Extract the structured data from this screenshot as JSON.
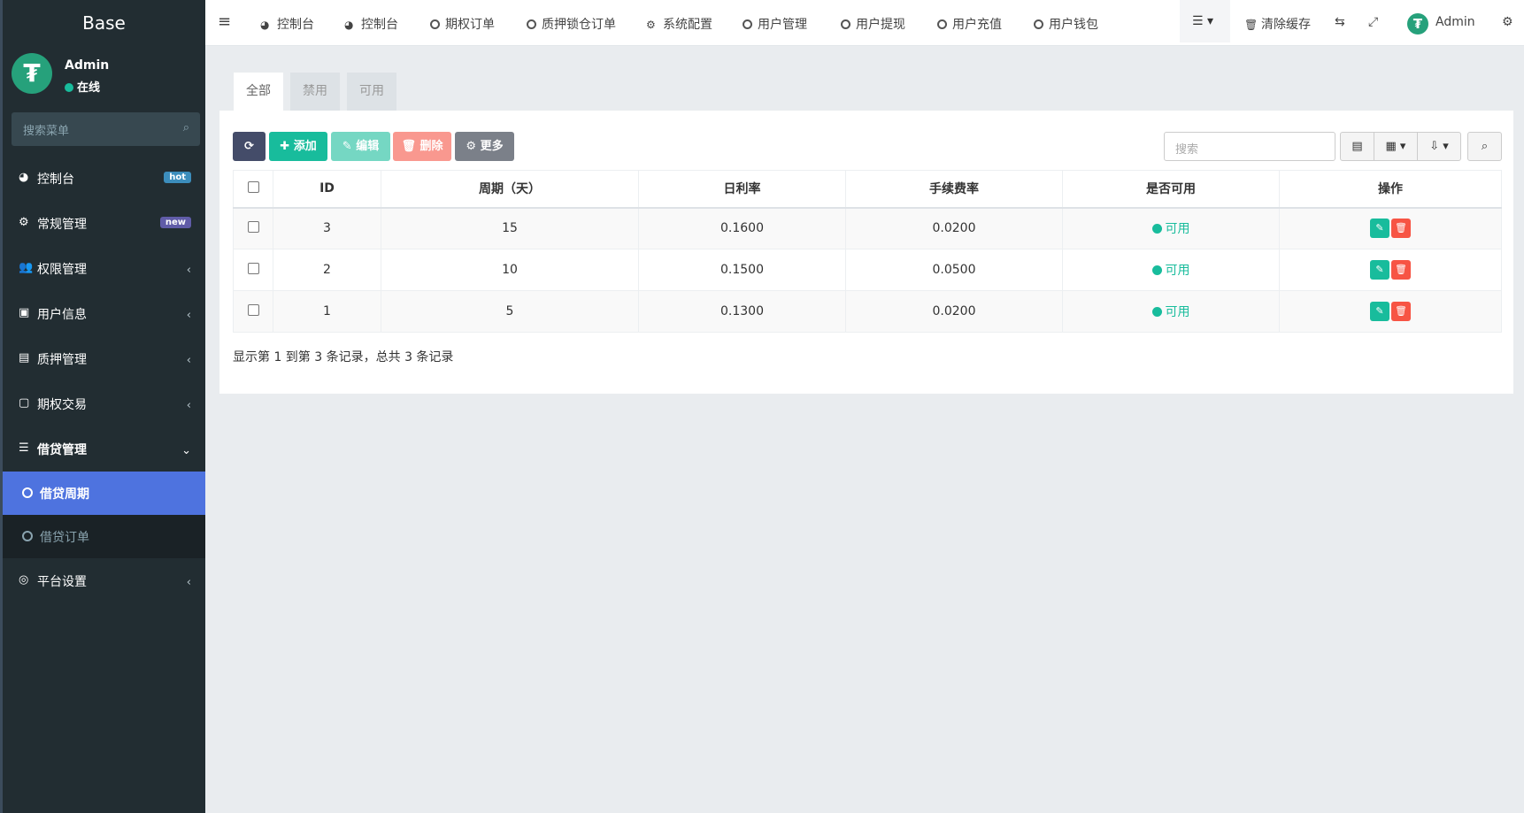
{
  "sidebar": {
    "brand": "Base",
    "user": {
      "avatar": "₮",
      "name": "Admin",
      "status": "在线"
    },
    "search_placeholder": "搜索菜单",
    "items": [
      {
        "label": "控制台",
        "icon": "dashboard-icon",
        "glyph": "◕",
        "badge": "hot"
      },
      {
        "label": "常规管理",
        "icon": "cogs-icon",
        "glyph": "⚙",
        "badge": "new"
      },
      {
        "label": "权限管理",
        "icon": "group-icon",
        "glyph": "👥",
        "arrow": "‹"
      },
      {
        "label": "用户信息",
        "icon": "user-card-icon",
        "glyph": "▣",
        "arrow": "‹"
      },
      {
        "label": "质押管理",
        "icon": "id-card-icon",
        "glyph": "▤",
        "arrow": "‹"
      },
      {
        "label": "期权交易",
        "icon": "file-icon",
        "glyph": "▢",
        "arrow": "‹"
      },
      {
        "label": "借贷管理",
        "icon": "list-icon",
        "glyph": "☰",
        "arrow": "⌄"
      }
    ],
    "sub_items": [
      {
        "label": "借贷周期",
        "active": true
      },
      {
        "label": "借贷订单",
        "active": false
      }
    ],
    "last_item": {
      "label": "平台设置",
      "icon": "target-icon",
      "glyph": "◎",
      "arrow": "‹"
    }
  },
  "topnav": {
    "hamburger": "≡",
    "links": [
      "控制台",
      "控制台",
      "期权订单",
      "质押锁仓订单",
      "系统配置",
      "用户管理",
      "用户提现",
      "用户充值",
      "用户钱包"
    ],
    "list_btn": "☰ ▾",
    "clear_cache": "清除缓存",
    "lang_icon": "⇆",
    "fullscreen_icon": "⤢",
    "admin_avatar": "₮",
    "admin_name": "Admin",
    "settings_icon": "⚙"
  },
  "tabs": [
    "全部",
    "禁用",
    "可用"
  ],
  "toolbar": {
    "refresh": "⟳",
    "add": "✚ 添加",
    "edit": "✎ 编辑",
    "delete": "🗑 删除",
    "more": "⚙ 更多",
    "search_placeholder": "搜索",
    "view_icon": "▤",
    "columns_icon": "▦ ▾",
    "export_icon": "⇩ ▾",
    "search_icon": "⌕"
  },
  "table": {
    "headers": [
      "ID",
      "周期（天）",
      "日利率",
      "手续费率",
      "是否可用",
      "操作"
    ],
    "rows": [
      {
        "id": "3",
        "period": "15",
        "rate": "0.1600",
        "fee": "0.0200",
        "status": "可用"
      },
      {
        "id": "2",
        "period": "10",
        "rate": "0.1500",
        "fee": "0.0500",
        "status": "可用"
      },
      {
        "id": "1",
        "period": "5",
        "rate": "0.1300",
        "fee": "0.0200",
        "status": "可用"
      }
    ],
    "edit_glyph": "✎",
    "delete_glyph": "🗑"
  },
  "pagination_text": "显示第 1 到第 3 条记录，总共 3 条记录",
  "colors": {
    "sidebar": "#222d32",
    "active": "#4e73df",
    "success": "#18bc9c",
    "danger": "#f75444"
  }
}
